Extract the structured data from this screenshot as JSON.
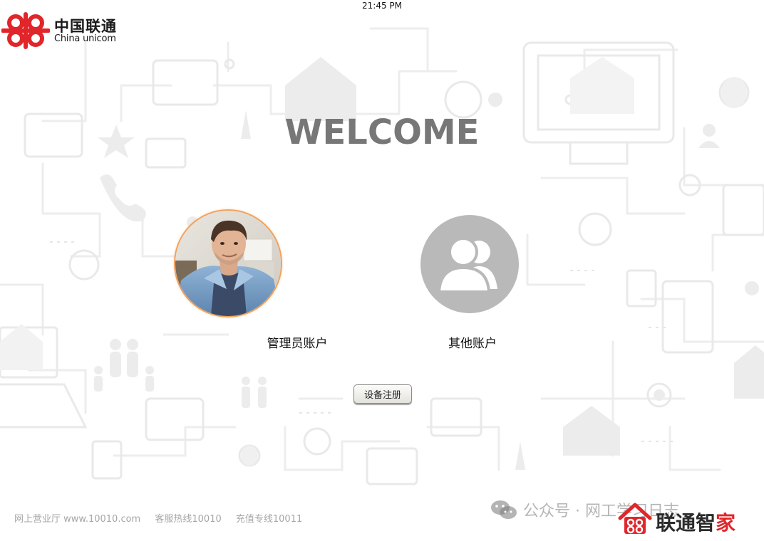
{
  "status_bar": {
    "time": "21:45 PM"
  },
  "brand": {
    "name_cn": "中国联通",
    "name_en": "China unicom"
  },
  "welcome": {
    "title": "WELCOME"
  },
  "accounts": [
    {
      "label": "管理员账户",
      "avatar": "admin-photo"
    },
    {
      "label": "其他账户",
      "avatar": "user-group-icon"
    }
  ],
  "register_button": {
    "label": "设备注册"
  },
  "footer": {
    "items": [
      "网上营业厅 www.10010.com",
      "客服热线10010",
      "充值专线10011"
    ]
  },
  "watermark": {
    "text": "公众号 · 网工学习日志",
    "icon": "wechat-icon"
  },
  "bottom_brand": {
    "text_main": "联通智",
    "text_accent": "家"
  },
  "colors": {
    "welcome_text": "#777777",
    "admin_ring": "#f2a05a",
    "other_avatar_bg": "#b9b9b9",
    "brand_red": "#e0262b",
    "footer_text": "#a6a6a6"
  }
}
